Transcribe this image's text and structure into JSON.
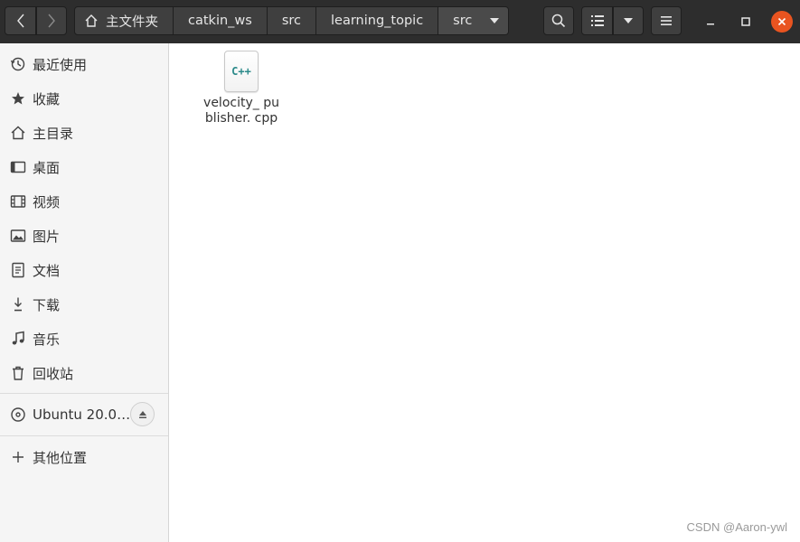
{
  "toolbar": {
    "breadcrumbs": [
      "主文件夹",
      "catkin_ws",
      "src",
      "learning_topic",
      "src"
    ]
  },
  "sidebar": {
    "items": [
      {
        "label": "最近使用",
        "icon": "clock-icon"
      },
      {
        "label": "收藏",
        "icon": "star-icon"
      },
      {
        "label": "主目录",
        "icon": "home-icon"
      },
      {
        "label": "桌面",
        "icon": "desktop-icon"
      },
      {
        "label": "视频",
        "icon": "film-icon"
      },
      {
        "label": "图片",
        "icon": "picture-icon"
      },
      {
        "label": "文档",
        "icon": "document-icon"
      },
      {
        "label": "下载",
        "icon": "download-icon"
      },
      {
        "label": "音乐",
        "icon": "music-icon"
      },
      {
        "label": "回收站",
        "icon": "trash-icon"
      }
    ],
    "device": {
      "label": "Ubuntu 20.0…",
      "icon": "disc-icon"
    },
    "other": {
      "label": "其他位置",
      "icon": "plus-icon"
    }
  },
  "files": [
    {
      "icon_text": "C++",
      "name": "velocity_ publisher. cpp"
    }
  ],
  "watermark": "CSDN @Aaron-ywl",
  "colors": {
    "titlebar": "#2d2d2d",
    "close_button": "#e95420",
    "cpp_icon": "#2b8a8a"
  }
}
